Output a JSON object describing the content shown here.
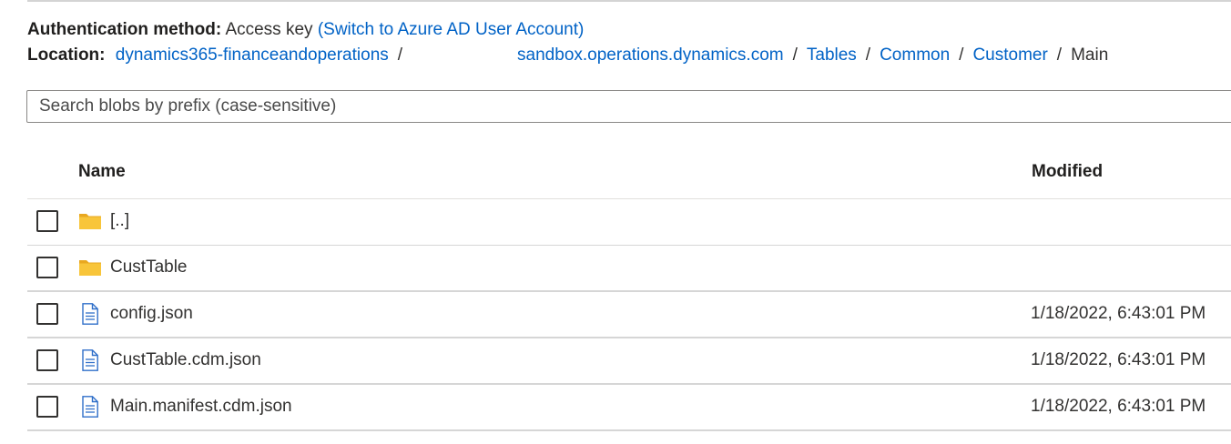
{
  "auth": {
    "label": "Authentication method:",
    "value": "Access key",
    "switch_link": "(Switch to Azure AD User Account)"
  },
  "location": {
    "label": "Location:",
    "crumbs": [
      "dynamics365-financeandoperations",
      "sandbox.operations.dynamics.com",
      "Tables",
      "Common",
      "Customer"
    ],
    "current": "Main",
    "separator": "/"
  },
  "search": {
    "placeholder": "Search blobs by prefix (case-sensitive)"
  },
  "table": {
    "headers": {
      "name": "Name",
      "modified": "Modified"
    },
    "rows": [
      {
        "icon": "folder-icon",
        "name": "[..]",
        "modified": ""
      },
      {
        "icon": "folder-icon",
        "name": "CustTable",
        "modified": ""
      },
      {
        "icon": "file-icon",
        "name": "config.json",
        "modified": "1/18/2022, 6:43:01 PM"
      },
      {
        "icon": "file-icon",
        "name": "CustTable.cdm.json",
        "modified": "1/18/2022, 6:43:01 PM"
      },
      {
        "icon": "file-icon",
        "name": "Main.manifest.cdm.json",
        "modified": "1/18/2022, 6:43:01 PM"
      }
    ]
  },
  "colors": {
    "link": "#0062c6",
    "folder": "#f8c53a",
    "file": "#2f6fc9"
  }
}
